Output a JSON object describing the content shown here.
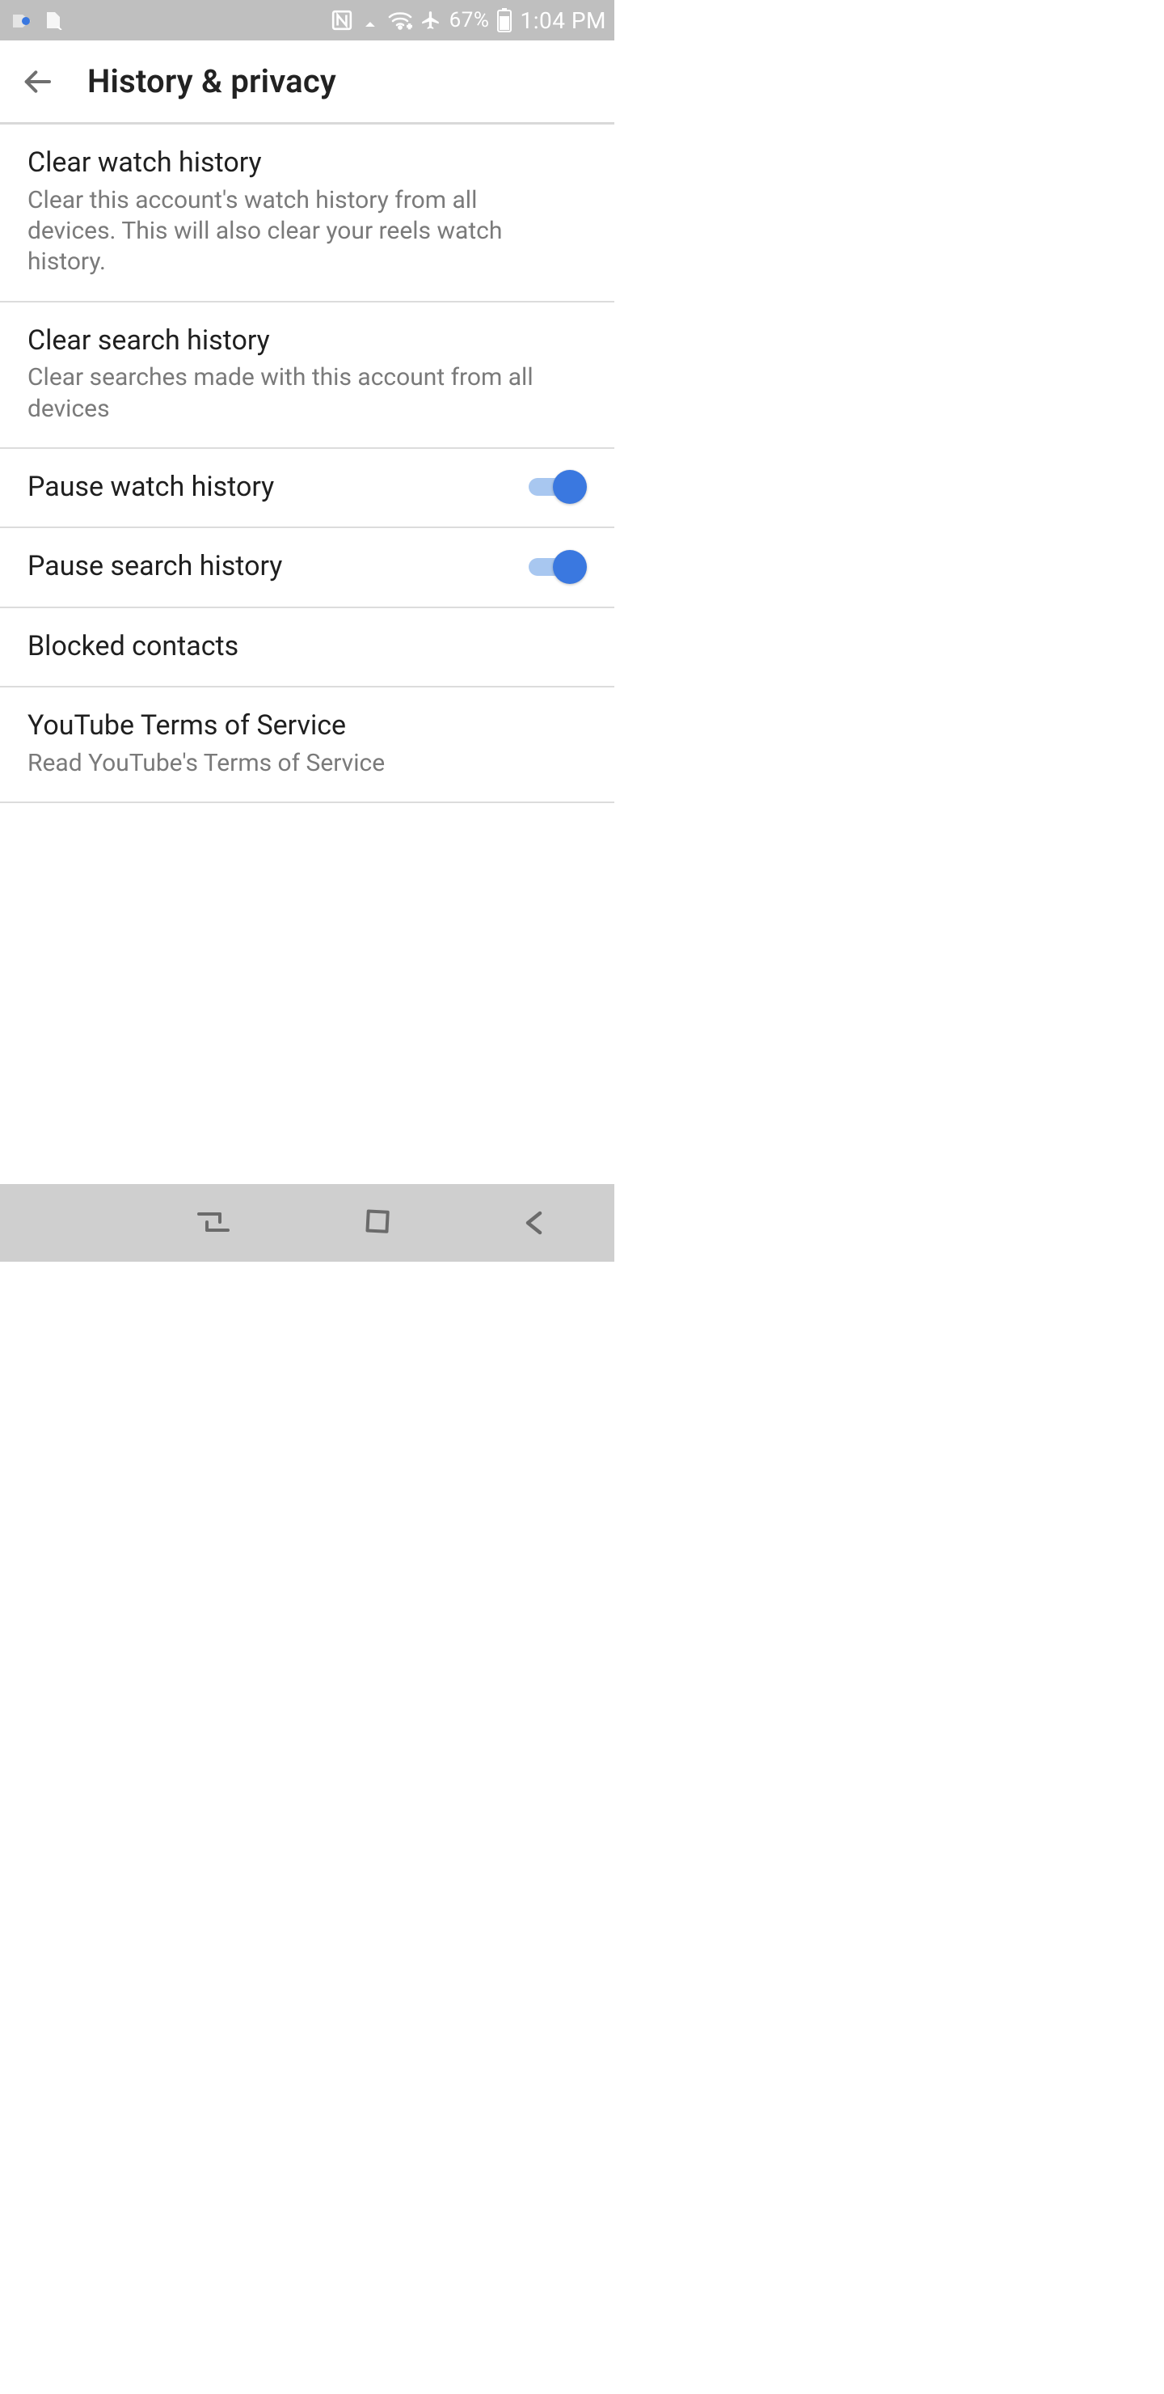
{
  "status": {
    "battery_percent": "67%",
    "clock": "1:04 PM"
  },
  "appbar": {
    "title": "History & privacy"
  },
  "items": {
    "clear_watch": {
      "title": "Clear watch history",
      "subtitle": "Clear this account's watch history from all devices. This will also clear your reels watch history."
    },
    "clear_search": {
      "title": "Clear search history",
      "subtitle": "Clear searches made with this account from all devices"
    },
    "pause_watch": {
      "title": "Pause watch history",
      "toggle_on": true
    },
    "pause_search": {
      "title": "Pause search history",
      "toggle_on": true
    },
    "blocked": {
      "title": "Blocked contacts"
    },
    "tos": {
      "title": "YouTube Terms of Service",
      "subtitle": "Read YouTube's Terms of Service"
    }
  },
  "colors": {
    "switch_thumb": "#3a78e0",
    "switch_track": "#a8c7f0",
    "divider": "#dcdcdc"
  }
}
